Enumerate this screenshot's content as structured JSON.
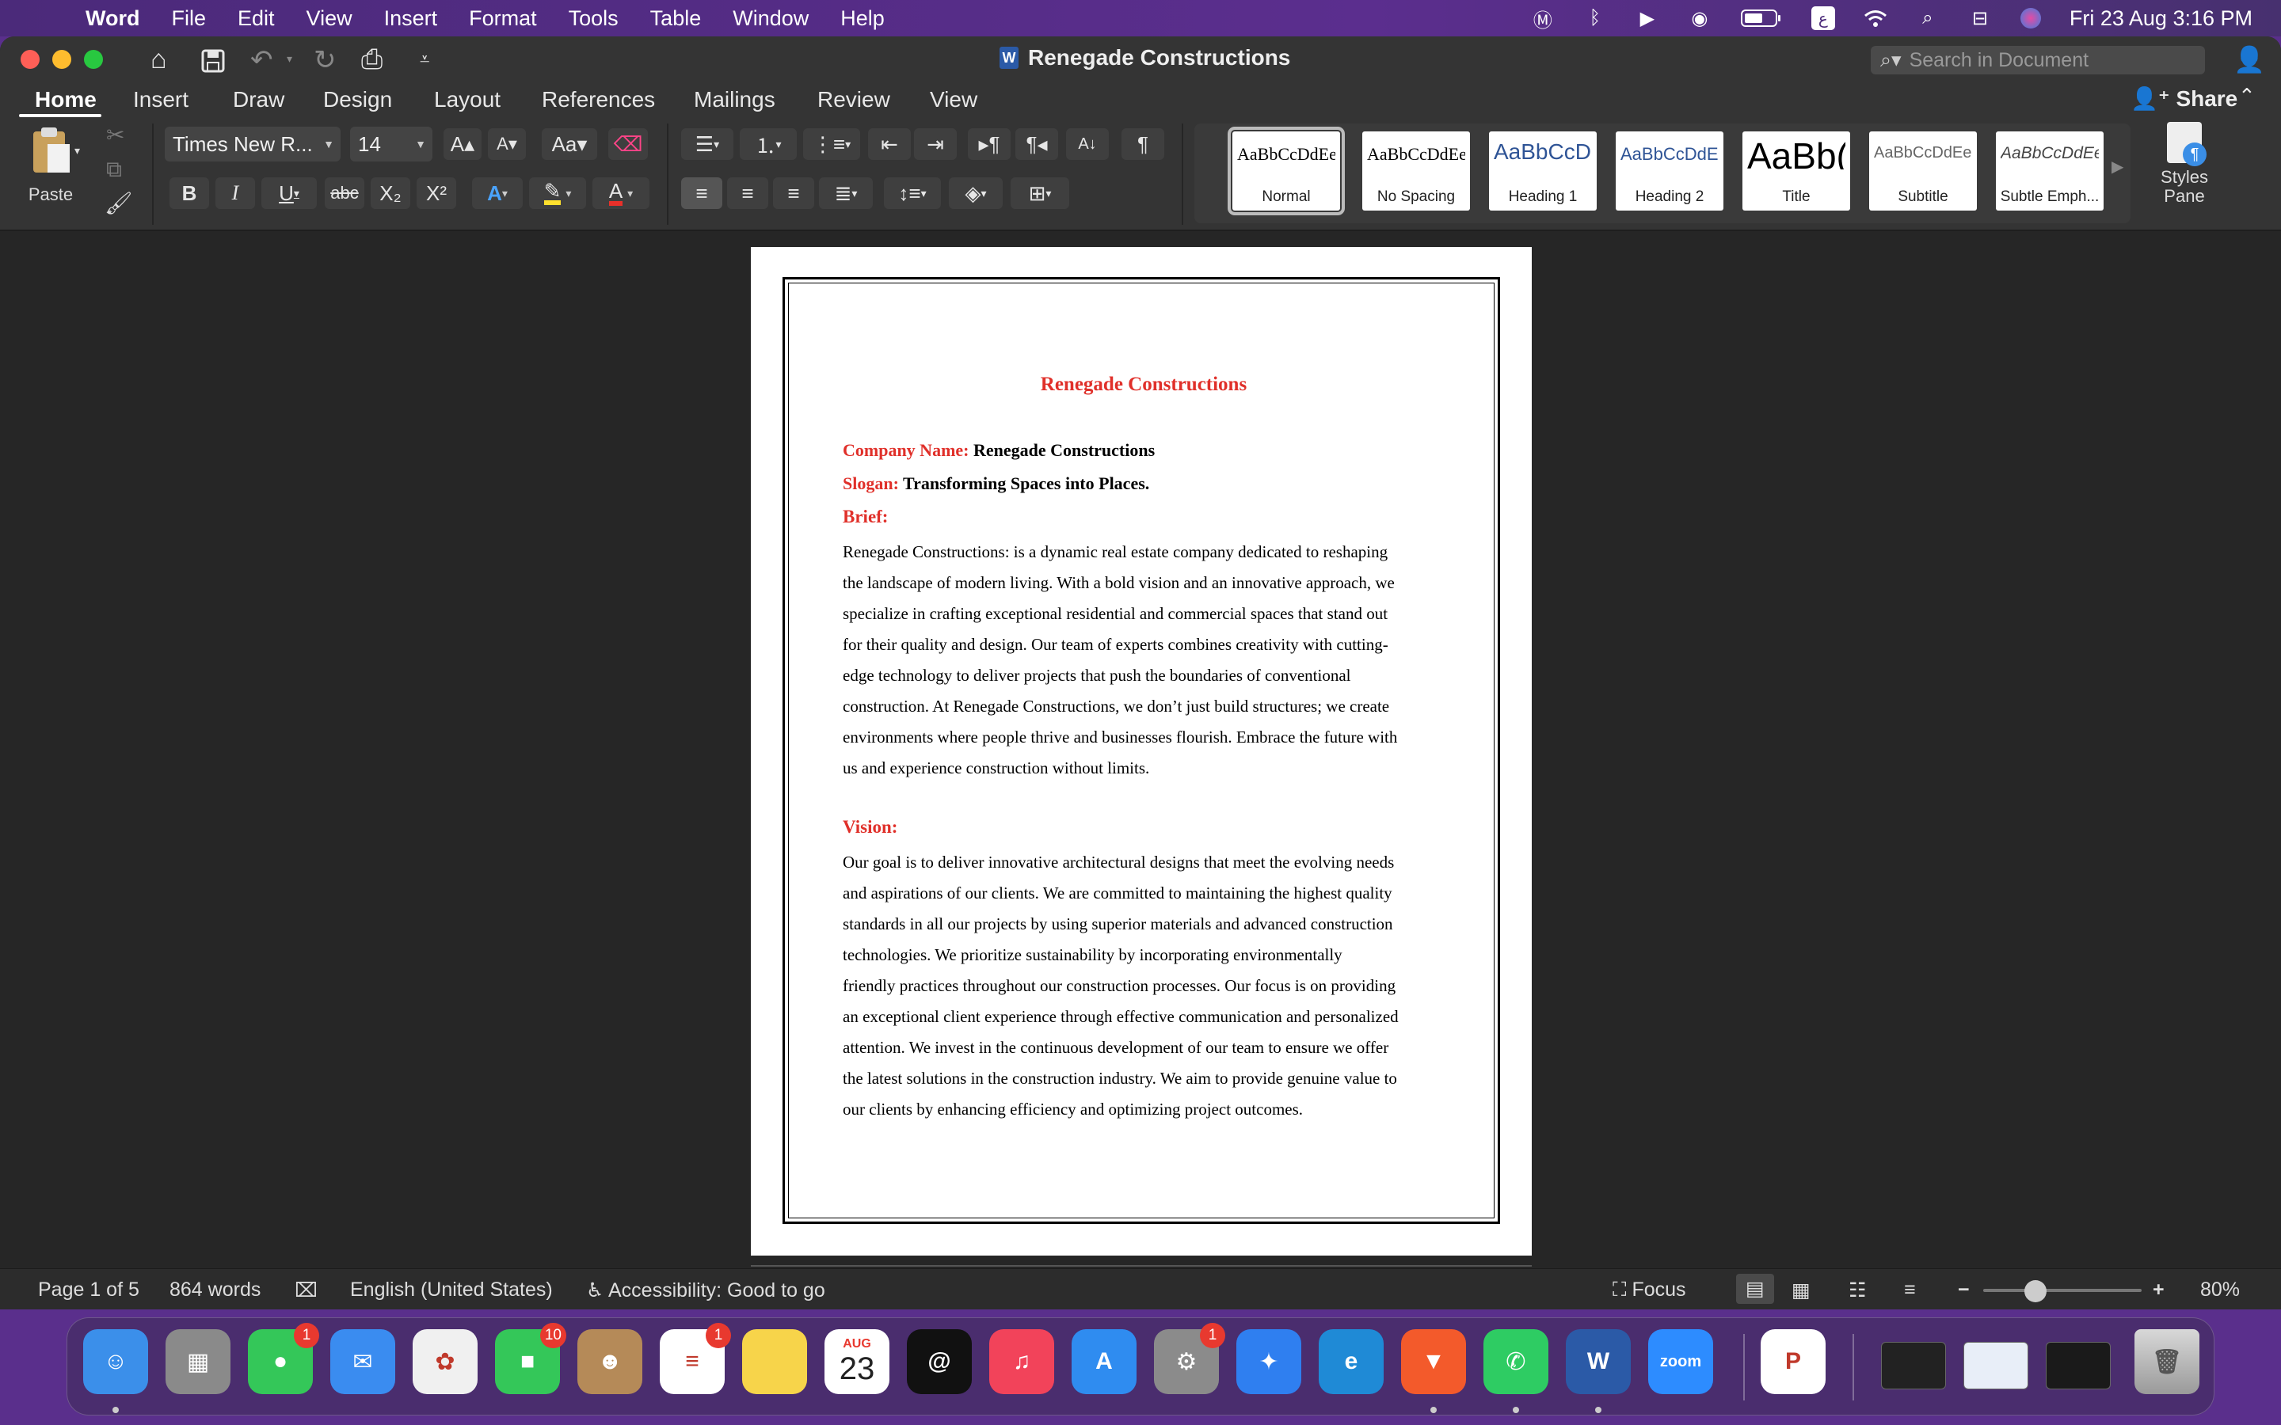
{
  "menubar": {
    "app_name": "Word",
    "items": [
      "File",
      "Edit",
      "View",
      "Insert",
      "Format",
      "Tools",
      "Table",
      "Window",
      "Help"
    ],
    "datetime": "Fri 23 Aug  3:16 PM"
  },
  "window": {
    "doc_title": "Renegade Constructions",
    "search_placeholder": "Search in Document"
  },
  "tabs": [
    "Home",
    "Insert",
    "Draw",
    "Design",
    "Layout",
    "References",
    "Mailings",
    "Review",
    "View"
  ],
  "share_label": "Share",
  "ribbon": {
    "paste_label": "Paste",
    "font_name": "Times New R...",
    "font_size": "14",
    "styles": [
      {
        "sample": "AaBbCcDdEe",
        "name": "Normal"
      },
      {
        "sample": "AaBbCcDdEe",
        "name": "No Spacing"
      },
      {
        "sample": "AaBbCcDd",
        "name": "Heading 1"
      },
      {
        "sample": "AaBbCcDdEe",
        "name": "Heading 2"
      },
      {
        "sample": "AaBb(",
        "name": "Title"
      },
      {
        "sample": "AaBbCcDdEe",
        "name": "Subtitle"
      },
      {
        "sample": "AaBbCcDdEe",
        "name": "Subtle Emph..."
      }
    ],
    "styles_pane_label": "Styles Pane"
  },
  "document": {
    "title": "Renegade Constructions",
    "company_label": "Company Name:",
    "company_value": "Renegade Constructions",
    "slogan_label": "Slogan:",
    "slogan_value": "Transforming Spaces into Places.",
    "brief_heading": "Brief:",
    "brief_lines": [
      "Renegade Constructions: is a dynamic real estate company dedicated to reshaping",
      "the landscape of modern living. With a bold vision and an innovative approach, we",
      "specialize in crafting exceptional residential and commercial spaces that stand out",
      "for their quality and design. Our team of experts combines creativity with cutting-",
      "edge technology to deliver projects that push the boundaries of conventional",
      "construction. At Renegade Constructions, we don’t just build structures; we create",
      "environments where people thrive and businesses flourish. Embrace the future with",
      "us and experience construction without limits."
    ],
    "vision_heading": "Vision:",
    "vision_lines": [
      "Our goal is to deliver innovative architectural designs that meet the evolving needs",
      "and aspirations of our clients. We are committed to maintaining the highest quality",
      "standards in all our projects by using superior materials and advanced construction",
      "technologies. We prioritize sustainability by incorporating environmentally",
      "friendly practices throughout our construction processes. Our focus is on providing",
      "an exceptional client experience through effective communication and personalized",
      "attention. We invest in the continuous development of our team to ensure we offer",
      "the latest solutions in the construction industry. We aim to provide genuine value to",
      "our clients by enhancing efficiency and optimizing project outcomes."
    ]
  },
  "statusbar": {
    "page": "Page 1 of 5",
    "words": "864 words",
    "language": "English (United States)",
    "accessibility": "Accessibility: Good to go",
    "focus": "Focus",
    "zoom": "80%",
    "zoom_level_fraction": 0.33
  },
  "dock": {
    "apps": [
      {
        "name": "Finder",
        "color": "#3b8fea",
        "glyph": "☺",
        "badge": ""
      },
      {
        "name": "Launchpad",
        "color": "#8a8a8a",
        "glyph": "▦",
        "badge": ""
      },
      {
        "name": "Messages",
        "color": "#34c759",
        "glyph": "●",
        "badge": "1"
      },
      {
        "name": "Mail",
        "color": "#3a8cf0",
        "glyph": "✉",
        "badge": ""
      },
      {
        "name": "Photos",
        "color": "#f0f0f0",
        "glyph": "✿",
        "badge": ""
      },
      {
        "name": "FaceTime",
        "color": "#34c759",
        "glyph": "■",
        "badge": "10"
      },
      {
        "name": "Contacts",
        "color": "#b58a58",
        "glyph": "☻",
        "badge": ""
      },
      {
        "name": "Reminders",
        "color": "#ffffff",
        "glyph": "≡",
        "badge": "1"
      },
      {
        "name": "Notes",
        "color": "#f7d44a",
        "glyph": "",
        "badge": ""
      },
      {
        "name": "Calendar",
        "color": "#ffffff",
        "glyph": "23",
        "month": "AUG",
        "badge": ""
      },
      {
        "name": "Arc",
        "color": "#111111",
        "glyph": "@",
        "badge": ""
      },
      {
        "name": "Music",
        "color": "#f2435a",
        "glyph": "♫",
        "badge": ""
      },
      {
        "name": "App Store",
        "color": "#2f8cf0",
        "glyph": "A",
        "badge": ""
      },
      {
        "name": "System Settings",
        "color": "#8b8b8b",
        "glyph": "⚙",
        "badge": "1"
      },
      {
        "name": "Safari",
        "color": "#2f7ff0",
        "glyph": "✦",
        "badge": ""
      },
      {
        "name": "Edge",
        "color": "#1f8ad6",
        "glyph": "e",
        "badge": ""
      },
      {
        "name": "Brave",
        "color": "#f35a2b",
        "glyph": "▼",
        "badge": ""
      },
      {
        "name": "WhatsApp",
        "color": "#2ecc63",
        "glyph": "✆",
        "badge": ""
      },
      {
        "name": "Word",
        "color": "#2b5aa7",
        "glyph": "W",
        "badge": ""
      },
      {
        "name": "Zoom",
        "color": "#2d8cff",
        "glyph": "zoom",
        "badge": ""
      },
      {
        "name": "PowerPoint",
        "color": "#ffffff",
        "glyph": "P",
        "badge": ""
      }
    ]
  }
}
